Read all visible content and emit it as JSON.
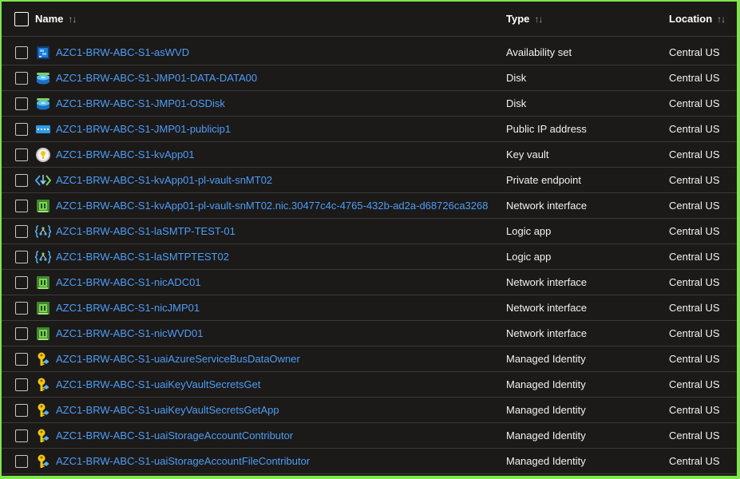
{
  "columns": {
    "name": "Name",
    "type": "Type",
    "location": "Location",
    "sort_glyph": "↑↓"
  },
  "rows": [
    {
      "name": "AZC1-BRW-ABC-S1-asWVD",
      "type": "Availability set",
      "location": "Central US",
      "icon": "availability-set-icon"
    },
    {
      "name": "AZC1-BRW-ABC-S1-JMP01-DATA-DATA00",
      "type": "Disk",
      "location": "Central US",
      "icon": "disk-icon"
    },
    {
      "name": "AZC1-BRW-ABC-S1-JMP01-OSDisk",
      "type": "Disk",
      "location": "Central US",
      "icon": "disk-icon"
    },
    {
      "name": "AZC1-BRW-ABC-S1-JMP01-publicip1",
      "type": "Public IP address",
      "location": "Central US",
      "icon": "public-ip-icon"
    },
    {
      "name": "AZC1-BRW-ABC-S1-kvApp01",
      "type": "Key vault",
      "location": "Central US",
      "icon": "key-vault-icon"
    },
    {
      "name": "AZC1-BRW-ABC-S1-kvApp01-pl-vault-snMT02",
      "type": "Private endpoint",
      "location": "Central US",
      "icon": "private-endpoint-icon"
    },
    {
      "name": "AZC1-BRW-ABC-S1-kvApp01-pl-vault-snMT02.nic.30477c4c-4765-432b-ad2a-d68726ca3268",
      "type": "Network interface",
      "location": "Central US",
      "icon": "network-interface-icon"
    },
    {
      "name": "AZC1-BRW-ABC-S1-laSMTP-TEST-01",
      "type": "Logic app",
      "location": "Central US",
      "icon": "logic-app-icon"
    },
    {
      "name": "AZC1-BRW-ABC-S1-laSMTPTEST02",
      "type": "Logic app",
      "location": "Central US",
      "icon": "logic-app-icon"
    },
    {
      "name": "AZC1-BRW-ABC-S1-nicADC01",
      "type": "Network interface",
      "location": "Central US",
      "icon": "network-interface-icon"
    },
    {
      "name": "AZC1-BRW-ABC-S1-nicJMP01",
      "type": "Network interface",
      "location": "Central US",
      "icon": "network-interface-icon"
    },
    {
      "name": "AZC1-BRW-ABC-S1-nicWVD01",
      "type": "Network interface",
      "location": "Central US",
      "icon": "network-interface-icon"
    },
    {
      "name": "AZC1-BRW-ABC-S1-uaiAzureServiceBusDataOwner",
      "type": "Managed Identity",
      "location": "Central US",
      "icon": "managed-identity-icon"
    },
    {
      "name": "AZC1-BRW-ABC-S1-uaiKeyVaultSecretsGet",
      "type": "Managed Identity",
      "location": "Central US",
      "icon": "managed-identity-icon"
    },
    {
      "name": "AZC1-BRW-ABC-S1-uaiKeyVaultSecretsGetApp",
      "type": "Managed Identity",
      "location": "Central US",
      "icon": "managed-identity-icon"
    },
    {
      "name": "AZC1-BRW-ABC-S1-uaiStorageAccountContributor",
      "type": "Managed Identity",
      "location": "Central US",
      "icon": "managed-identity-icon"
    },
    {
      "name": "AZC1-BRW-ABC-S1-uaiStorageAccountFileContributor",
      "type": "Managed Identity",
      "location": "Central US",
      "icon": "managed-identity-icon"
    }
  ],
  "colors": {
    "background": "#1b1a19",
    "link": "#4f9cf5",
    "text": "#f3f2f1",
    "border": "#3b3a39",
    "frame": "#7ee54b"
  }
}
